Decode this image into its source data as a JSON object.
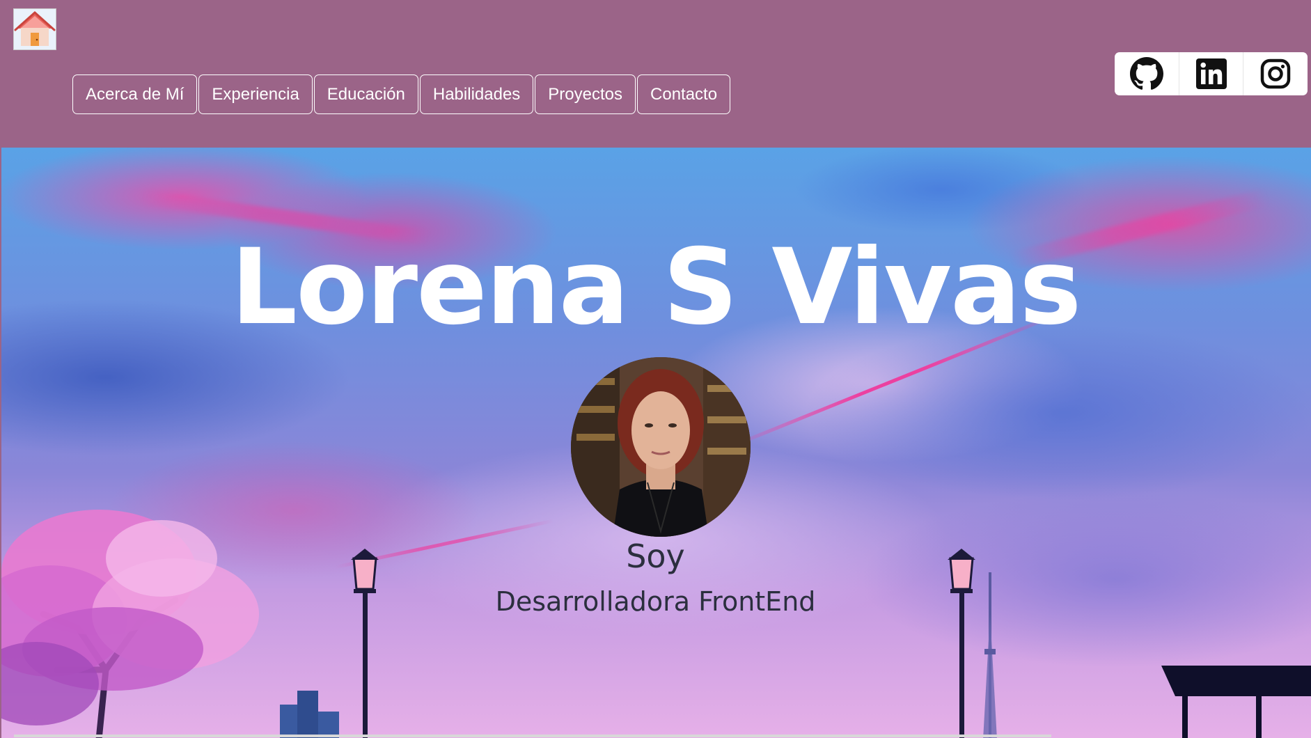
{
  "header": {
    "home_icon": "house-icon",
    "nav": [
      {
        "label": "Acerca de Mí"
      },
      {
        "label": "Experiencia"
      },
      {
        "label": "Educación"
      },
      {
        "label": "Habilidades"
      },
      {
        "label": "Proyectos"
      },
      {
        "label": "Contacto"
      }
    ],
    "social": [
      {
        "icon": "github-icon"
      },
      {
        "icon": "linkedin-icon"
      },
      {
        "icon": "instagram-icon"
      }
    ],
    "background_color": "#9b6488"
  },
  "hero": {
    "title": "Lorena S Vivas",
    "intro": "Soy",
    "role": "Desarrolladora FrontEnd",
    "accent_color": "#ec40a0"
  }
}
